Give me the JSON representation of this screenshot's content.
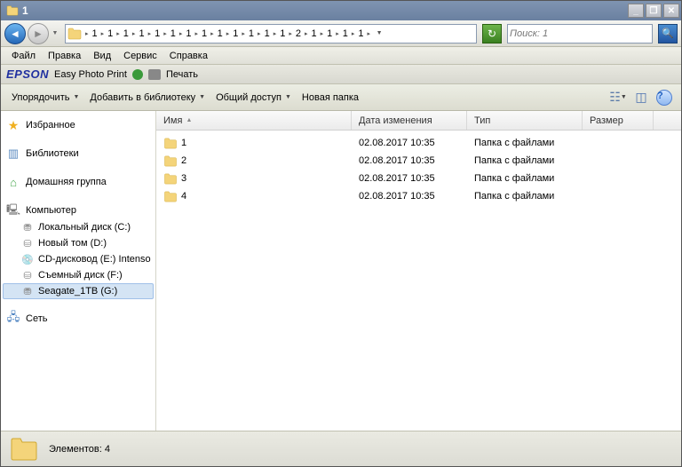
{
  "title": "1",
  "breadcrumb": [
    "1",
    "1",
    "1",
    "1",
    "1",
    "1",
    "1",
    "1",
    "1",
    "1",
    "1",
    "1",
    "1",
    "2",
    "1",
    "1",
    "1",
    "1"
  ],
  "search": {
    "placeholder": "Поиск: 1"
  },
  "menu": {
    "file": "Файл",
    "edit": "Правка",
    "view": "Вид",
    "tools": "Сервис",
    "help": "Справка"
  },
  "epson": {
    "logo": "EPSON",
    "app": "Easy Photo Print",
    "print": "Печать"
  },
  "toolbar": {
    "organize": "Упорядочить",
    "addlib": "Добавить в библиотеку",
    "share": "Общий доступ",
    "newfolder": "Новая папка"
  },
  "sidebar": {
    "favorites": "Избранное",
    "libraries": "Библиотеки",
    "homegroup": "Домашняя группа",
    "computer": "Компьютер",
    "network": "Сеть",
    "drives": [
      "Локальный диск (C:)",
      "Новый том (D:)",
      "CD-дисковод (E:) Intenso",
      "Съемный диск (F:)",
      "Seagate_1TB (G:)"
    ]
  },
  "columns": {
    "name": "Имя",
    "date": "Дата изменения",
    "type": "Тип",
    "size": "Размер"
  },
  "rows": [
    {
      "name": "1",
      "date": "02.08.2017 10:35",
      "type": "Папка с файлами"
    },
    {
      "name": "2",
      "date": "02.08.2017 10:35",
      "type": "Папка с файлами"
    },
    {
      "name": "3",
      "date": "02.08.2017 10:35",
      "type": "Папка с файлами"
    },
    {
      "name": "4",
      "date": "02.08.2017 10:35",
      "type": "Папка с файлами"
    }
  ],
  "status": "Элементов: 4"
}
